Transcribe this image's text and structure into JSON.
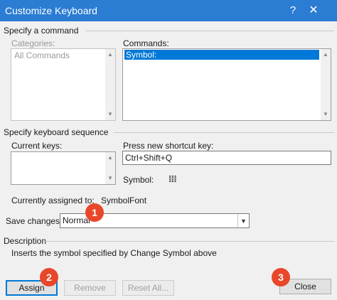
{
  "window": {
    "title": "Customize Keyboard",
    "help_symbol": "?",
    "close_symbol": "✕"
  },
  "command_section": {
    "label": "Specify a command",
    "categories_label": "Categories:",
    "categories_items": [
      "All Commands"
    ],
    "commands_label": "Commands:",
    "commands_items": [
      "Symbol:"
    ]
  },
  "keyboard_section": {
    "label": "Specify keyboard sequence",
    "current_keys_label": "Current keys:",
    "press_new_label": "Press new shortcut key:",
    "press_new_value": "Ctrl+Shift+Q",
    "symbol_label": "Symbol:",
    "symbol_glyph": "𝍖",
    "assigned_label": "Currently assigned to:",
    "assigned_value": "SymbolFont",
    "save_label": "Save changes in:",
    "save_value": "Normal"
  },
  "description": {
    "label": "Description",
    "text": "Inserts the symbol specified by Change Symbol above"
  },
  "buttons": {
    "assign": "Assign",
    "remove": "Remove",
    "reset_all": "Reset All...",
    "close": "Close"
  },
  "badges": [
    "1",
    "2",
    "3"
  ],
  "colors": {
    "titlebar": "#2b7cd3",
    "selection": "#0078d7",
    "badge": "#e8472a"
  }
}
